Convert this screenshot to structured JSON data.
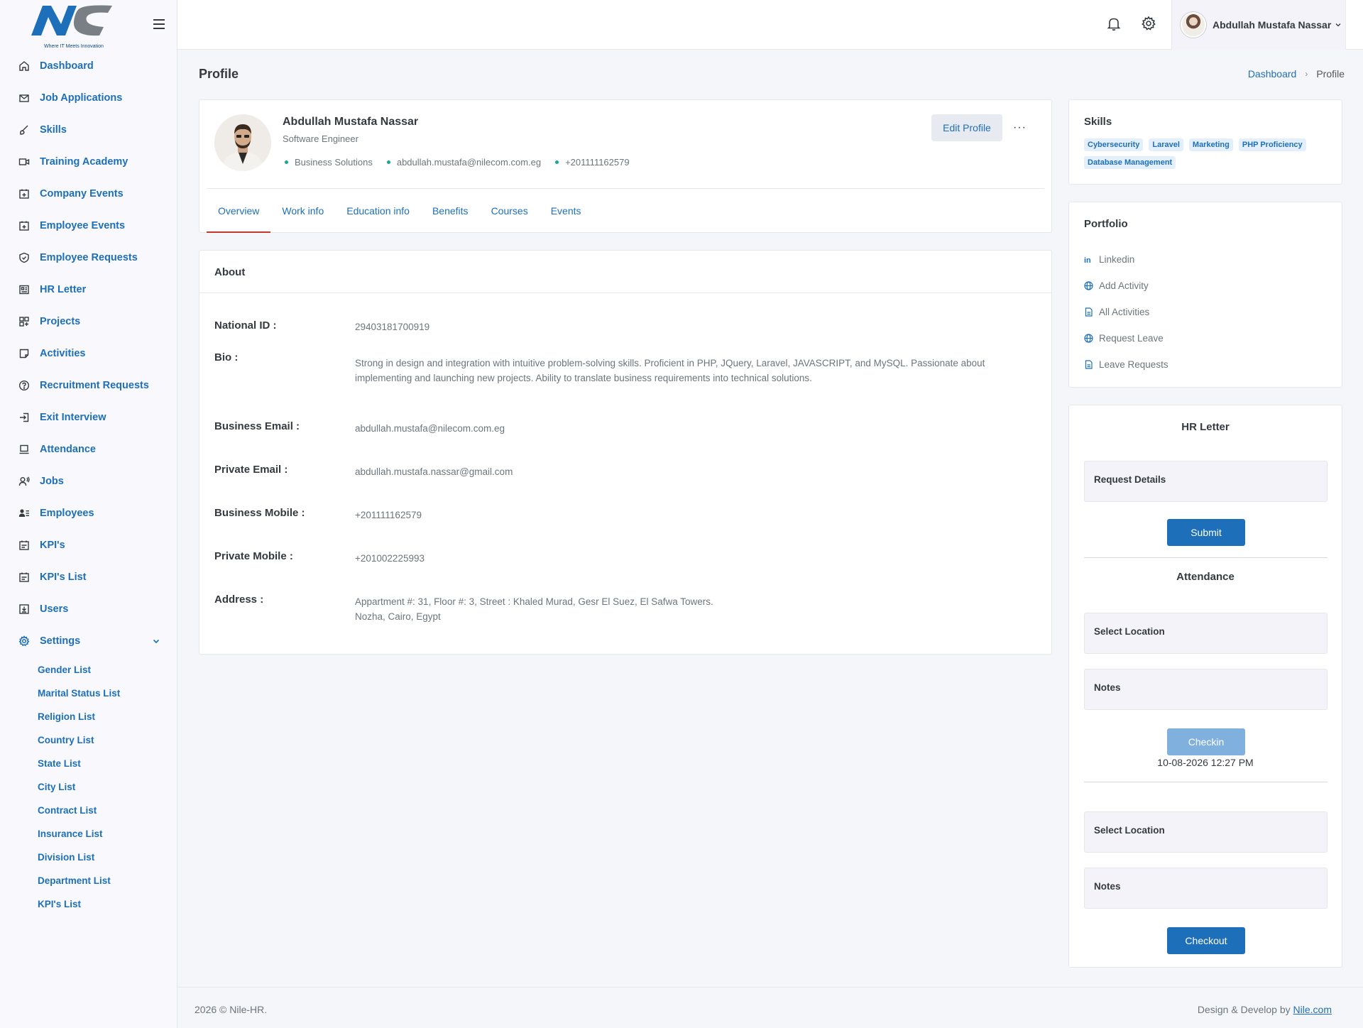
{
  "brand": {
    "logo_text": "NC",
    "tagline": "Where IT Meets Innovation"
  },
  "sidebar": {
    "items": [
      {
        "label": "Dashboard",
        "icon": "home-icon"
      },
      {
        "label": "Job Applications",
        "icon": "mail-open-icon"
      },
      {
        "label": "Skills",
        "icon": "brush-icon"
      },
      {
        "label": "Training Academy",
        "icon": "video-icon"
      },
      {
        "label": "Company Events",
        "icon": "calendar-plus-icon"
      },
      {
        "label": "Employee Events",
        "icon": "calendar-plus-icon"
      },
      {
        "label": "Employee Requests",
        "icon": "shield-icon"
      },
      {
        "label": "HR Letter",
        "icon": "newspaper-icon"
      },
      {
        "label": "Projects",
        "icon": "grid-plus-icon"
      },
      {
        "label": "Activities",
        "icon": "sticky-note-icon"
      },
      {
        "label": "Recruitment Requests",
        "icon": "question-circle-icon"
      },
      {
        "label": "Exit Interview",
        "icon": "sign-in-icon"
      },
      {
        "label": "Attendance",
        "icon": "laptop-icon"
      },
      {
        "label": "Jobs",
        "icon": "user-voice-icon"
      },
      {
        "label": "Employees",
        "icon": "user-list-icon"
      },
      {
        "label": "KPI's",
        "icon": "calendar-check-icon"
      },
      {
        "label": "KPI's List",
        "icon": "calendar-check-icon"
      },
      {
        "label": "Users",
        "icon": "download-box-icon"
      },
      {
        "label": "Settings",
        "icon": "gear-icon"
      }
    ],
    "settings_sub": [
      "Gender List",
      "Marital Status List",
      "Religion List",
      "Country List",
      "State List",
      "City List",
      "Contract List",
      "Insurance List",
      "Division List",
      "Department List",
      "KPI's List"
    ]
  },
  "topbar": {
    "user_name": "Abdullah Mustafa Nassar"
  },
  "page": {
    "title": "Profile",
    "breadcrumb": [
      "Dashboard",
      "Profile"
    ]
  },
  "profile": {
    "name": "Abdullah Mustafa Nassar",
    "role": "Software Engineer",
    "department": "Business Solutions",
    "email": "abdullah.mustafa@nilecom.com.eg",
    "phone": "+201111162579",
    "edit_label": "Edit Profile",
    "more_label": "···",
    "tabs": [
      "Overview",
      "Work info",
      "Education info",
      "Benefits",
      "Courses",
      "Events"
    ]
  },
  "about": {
    "title": "About",
    "fields": [
      {
        "label": "National ID :",
        "value": "29403181700919"
      },
      {
        "label": "Bio :",
        "value": "Strong in design and integration with intuitive problem-solving skills. Proficient in PHP, JQuery, Laravel, JAVASCRIPT, and MySQL. Passionate about implementing and launching new projects. Ability to translate business requirements into technical solutions."
      },
      {
        "label": "Business Email :",
        "value": "abdullah.mustafa@nilecom.com.eg"
      },
      {
        "label": "Private Email :",
        "value": "abdullah.mustafa.nassar@gmail.com"
      },
      {
        "label": "Business Mobile :",
        "value": "+201111162579"
      },
      {
        "label": "Private Mobile :",
        "value": "+201002225993"
      },
      {
        "label": "Address :",
        "value": "Appartment #: 31, Floor #: 3, Street : Khaled Murad, Gesr El Suez, El Safwa Towers.",
        "value2": "Nozha, Cairo, Egypt"
      }
    ]
  },
  "skills": {
    "title": "Skills",
    "tags": [
      "Cybersecurity",
      "Laravel",
      "Marketing",
      "PHP Proficiency",
      "Database Management"
    ]
  },
  "portfolio": {
    "title": "Portfolio",
    "links": [
      {
        "label": "Linkedin",
        "icon": "linkedin-icon"
      },
      {
        "label": "Add Activity",
        "icon": "globe-icon"
      },
      {
        "label": "All Activities",
        "icon": "file-icon"
      },
      {
        "label": "Request Leave",
        "icon": "globe-icon"
      },
      {
        "label": "Leave Requests",
        "icon": "file-icon"
      }
    ]
  },
  "hr_letter": {
    "title": "HR Letter",
    "request_details": "Request Details",
    "submit": "Submit"
  },
  "attendance": {
    "title": "Attendance",
    "select_location": "Select Location",
    "notes": "Notes",
    "checkin": "Checkin",
    "datetime": "10-08-2026 12:27 PM",
    "checkout": "Checkout"
  },
  "footer": {
    "left": "2026 © Nile-HR.",
    "right_prefix": "Design & Develop by",
    "right_link": "Nile.com"
  },
  "colors": {
    "primary": "#1e6fba",
    "accent_dot": "#1aa59a",
    "tab_underline": "#c0392b"
  }
}
